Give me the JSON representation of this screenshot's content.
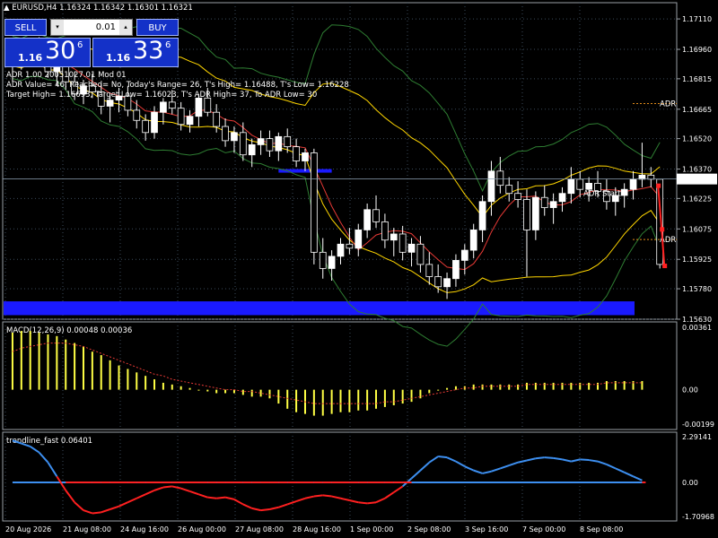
{
  "chart_title": {
    "symbol_tf": "EURUSD,H4",
    "ohlc": "1.16324 1.16342 1.16301 1.16321"
  },
  "trade_panel": {
    "sell_label": "SELL",
    "buy_label": "BUY",
    "lot_value": "0.01",
    "sell_price_small": "1.16",
    "sell_price_big": "30",
    "sell_price_sup": "6",
    "buy_price_small": "1.16",
    "buy_price_big": "33",
    "buy_price_sup": "6"
  },
  "indicator_info": {
    "line1": "ADR 1.00 20051027.01 Mod 01",
    "line2": "ADR Value= 46, Reached= No, Today's Range= 26, T's High= 1.16488, T's Low= 1.16228",
    "line3": "Target High= 1.16693, Target Low= 1.16023, T's ADR High= 37, To ADR Low= 30"
  },
  "chart_labels": {
    "adr_high": "ADR",
    "adr_low": "ADR",
    "adr_start": "ADR Start",
    "current_price": "1.16321"
  },
  "colors": {
    "background": "#000000",
    "grid": "#3a4a5a",
    "bull_candle": "#ffffff",
    "bear_candle": "#000000",
    "band_outer": "#2e7d32",
    "band_inner": "#ffd600",
    "ma_red": "#e53935",
    "zone_blue": "#1a1aff",
    "macd_hist": "#ffff44",
    "macd_signal": "#e53935",
    "trend_up": "#3d8ff0",
    "trend_down": "#ff2020",
    "adr_orange": "#e08a1a"
  },
  "chart_data": [
    {
      "type": "candlestick",
      "symbol": "EURUSD",
      "timeframe": "H4",
      "title": "EURUSD,H4 1.16324 1.16342 1.16301 1.16321",
      "ylim": [
        1.1563,
        1.1719
      ],
      "y_ticks": [
        "1.17110",
        "1.16960",
        "1.16815",
        "1.16665",
        "1.16520",
        "1.16370",
        "1.16225",
        "1.16075",
        "1.15925",
        "1.15780",
        "1.15630"
      ],
      "x_ticks": [
        "20 Aug 2026",
        "21 Aug 08:00",
        "24 Aug 16:00",
        "26 Aug 00:00",
        "27 Aug 08:00",
        "28 Aug 16:00",
        "1 Sep 00:00",
        "2 Sep 08:00",
        "3 Sep 16:00",
        "7 Sep 00:00",
        "8 Sep 08:00"
      ],
      "last_price": 1.16321,
      "adr_target_high": 1.16693,
      "adr_target_low": 1.16023,
      "candles": [
        [
          1.1688,
          1.1694,
          1.168,
          1.1692
        ],
        [
          1.1692,
          1.1697,
          1.1686,
          1.169
        ],
        [
          1.169,
          1.1699,
          1.1688,
          1.1697
        ],
        [
          1.1697,
          1.1702,
          1.169,
          1.1693
        ],
        [
          1.1693,
          1.1697,
          1.1682,
          1.1685
        ],
        [
          1.1685,
          1.1692,
          1.1678,
          1.1689
        ],
        [
          1.1689,
          1.1694,
          1.1676,
          1.168
        ],
        [
          1.168,
          1.1685,
          1.1671,
          1.1674
        ],
        [
          1.1674,
          1.1681,
          1.1669,
          1.1678
        ],
        [
          1.1678,
          1.1684,
          1.1672,
          1.1675
        ],
        [
          1.1675,
          1.1679,
          1.1664,
          1.1668
        ],
        [
          1.1668,
          1.1674,
          1.166,
          1.1671
        ],
        [
          1.1671,
          1.1677,
          1.1665,
          1.1673
        ],
        [
          1.1673,
          1.1678,
          1.1663,
          1.1666
        ],
        [
          1.1666,
          1.1671,
          1.1657,
          1.1661
        ],
        [
          1.1661,
          1.1664,
          1.1651,
          1.1655
        ],
        [
          1.1655,
          1.1668,
          1.1652,
          1.1665
        ],
        [
          1.1665,
          1.1672,
          1.1659,
          1.167
        ],
        [
          1.167,
          1.1676,
          1.1664,
          1.1667
        ],
        [
          1.1667,
          1.167,
          1.1656,
          1.1659
        ],
        [
          1.1659,
          1.1666,
          1.1655,
          1.1663
        ],
        [
          1.1663,
          1.1674,
          1.1658,
          1.1672
        ],
        [
          1.1672,
          1.1677,
          1.1663,
          1.1665
        ],
        [
          1.1665,
          1.1669,
          1.1655,
          1.1658
        ],
        [
          1.1658,
          1.1662,
          1.1648,
          1.1651
        ],
        [
          1.1651,
          1.1658,
          1.1645,
          1.1655
        ],
        [
          1.1655,
          1.166,
          1.1641,
          1.1644
        ],
        [
          1.1644,
          1.1652,
          1.1638,
          1.1649
        ],
        [
          1.1649,
          1.1656,
          1.1644,
          1.1652
        ],
        [
          1.1652,
          1.1656,
          1.1643,
          1.1646
        ],
        [
          1.1646,
          1.1655,
          1.1641,
          1.1653
        ],
        [
          1.1653,
          1.1657,
          1.1645,
          1.1648
        ],
        [
          1.1648,
          1.1652,
          1.1638,
          1.1641
        ],
        [
          1.1641,
          1.1647,
          1.1636,
          1.1645
        ],
        [
          1.1645,
          1.1647,
          1.159,
          1.1596
        ],
        [
          1.1596,
          1.1603,
          1.1583,
          1.1588
        ],
        [
          1.1588,
          1.1597,
          1.1582,
          1.1594
        ],
        [
          1.1594,
          1.1603,
          1.159,
          1.16
        ],
        [
          1.16,
          1.1608,
          1.1595,
          1.1598
        ],
        [
          1.1598,
          1.161,
          1.1594,
          1.1607
        ],
        [
          1.1607,
          1.162,
          1.1603,
          1.1617
        ],
        [
          1.1617,
          1.1624,
          1.1608,
          1.1611
        ],
        [
          1.1611,
          1.1615,
          1.1598,
          1.1602
        ],
        [
          1.1602,
          1.1608,
          1.1594,
          1.1605
        ],
        [
          1.1605,
          1.1609,
          1.1592,
          1.1596
        ],
        [
          1.1596,
          1.1603,
          1.1589,
          1.16
        ],
        [
          1.16,
          1.1604,
          1.1586,
          1.159
        ],
        [
          1.159,
          1.1596,
          1.158,
          1.1584
        ],
        [
          1.1584,
          1.159,
          1.1576,
          1.1579
        ],
        [
          1.1579,
          1.1586,
          1.1573,
          1.1583
        ],
        [
          1.1583,
          1.1595,
          1.1579,
          1.1592
        ],
        [
          1.1592,
          1.16,
          1.1585,
          1.1597
        ],
        [
          1.1597,
          1.161,
          1.1593,
          1.1607
        ],
        [
          1.1607,
          1.1624,
          1.1601,
          1.1621
        ],
        [
          1.1621,
          1.1641,
          1.1614,
          1.1636
        ],
        [
          1.1636,
          1.1643,
          1.1625,
          1.1629
        ],
        [
          1.1629,
          1.1633,
          1.1621,
          1.1625
        ],
        [
          1.1625,
          1.1631,
          1.1618,
          1.1622
        ],
        [
          1.1622,
          1.1627,
          1.1584,
          1.1607
        ],
        [
          1.1607,
          1.1626,
          1.1602,
          1.1623
        ],
        [
          1.1623,
          1.1629,
          1.1614,
          1.1618
        ],
        [
          1.1618,
          1.1625,
          1.161,
          1.1621
        ],
        [
          1.1621,
          1.1628,
          1.1616,
          1.1625
        ],
        [
          1.1625,
          1.1638,
          1.162,
          1.1632
        ],
        [
          1.1632,
          1.1636,
          1.1623,
          1.1627
        ],
        [
          1.1627,
          1.1633,
          1.1621,
          1.163
        ],
        [
          1.163,
          1.1636,
          1.1623,
          1.1626
        ],
        [
          1.1626,
          1.1632,
          1.1617,
          1.1621
        ],
        [
          1.1621,
          1.1628,
          1.1614,
          1.1624
        ],
        [
          1.1624,
          1.163,
          1.1618,
          1.1627
        ],
        [
          1.1627,
          1.1636,
          1.1622,
          1.1632
        ],
        [
          1.1632,
          1.165,
          1.1628,
          1.1634
        ],
        [
          1.1634,
          1.1638,
          1.1628,
          1.1632
        ],
        [
          1.1632,
          1.1632,
          1.1588,
          1.159
        ]
      ],
      "indicators": [
        {
          "name": "Bollinger outer",
          "color": "green"
        },
        {
          "name": "Envelope inner",
          "color": "yellow"
        },
        {
          "name": "Moving average",
          "color": "red"
        }
      ]
    },
    {
      "type": "bar",
      "title": "MACD(12,26,9) 0.00048 0.00036",
      "ylim": [
        -0.00199,
        0.00361
      ],
      "y_ticks": [
        "0.00361",
        "0.00",
        "-0.00199"
      ],
      "values": [
        0.0033,
        0.0034,
        0.0034,
        0.0033,
        0.0032,
        0.0031,
        0.0029,
        0.0027,
        0.0025,
        0.0022,
        0.002,
        0.0017,
        0.0014,
        0.0012,
        0.001,
        0.0008,
        0.0006,
        0.0004,
        0.0003,
        0.0002,
        0.0001,
        0.0,
        -0.0001,
        -0.0002,
        -0.0002,
        -0.0002,
        -0.0003,
        -0.0004,
        -0.0004,
        -0.0005,
        -0.0008,
        -0.0011,
        -0.0013,
        -0.0014,
        -0.0015,
        -0.0015,
        -0.0014,
        -0.0013,
        -0.0013,
        -0.0012,
        -0.0012,
        -0.0011,
        -0.001,
        -0.0009,
        -0.0008,
        -0.0007,
        -0.0005,
        -0.0002,
        0.0,
        0.0001,
        0.0002,
        0.0002,
        0.0003,
        0.0003,
        0.0003,
        0.0003,
        0.0003,
        0.0003,
        0.0004,
        0.0004,
        0.0004,
        0.0004,
        0.0004,
        0.0004,
        0.0004,
        0.0004,
        0.0004,
        0.0005,
        0.0005,
        0.0005,
        0.0005,
        0.0005
      ],
      "signal": [
        0.0022,
        0.0024,
        0.0025,
        0.0026,
        0.0027,
        0.0027,
        0.0027,
        0.0026,
        0.0025,
        0.0023,
        0.0021,
        0.0019,
        0.0017,
        0.0015,
        0.0013,
        0.0011,
        0.0009,
        0.0008,
        0.0006,
        0.0005,
        0.0004,
        0.0003,
        0.0002,
        0.0001,
        0.0,
        0.0,
        -0.0001,
        -0.0001,
        -0.0002,
        -0.0003,
        -0.0004,
        -0.0005,
        -0.0006,
        -0.0007,
        -0.0008,
        -0.0008,
        -0.0008,
        -0.0008,
        -0.0008,
        -0.0008,
        -0.0008,
        -0.0008,
        -0.0007,
        -0.0007,
        -0.0006,
        -0.0005,
        -0.0004,
        -0.0003,
        -0.0002,
        -0.0001,
        0.0,
        0.0001,
        0.0001,
        0.0002,
        0.0002,
        0.0002,
        0.0002,
        0.0002,
        0.0003,
        0.0003,
        0.0003,
        0.0003,
        0.0003,
        0.0003,
        0.0003,
        0.0003,
        0.0003,
        0.0004,
        0.0004,
        0.0004,
        0.0004,
        0.0004
      ]
    },
    {
      "type": "line",
      "title": "trendline_fast 0.06401",
      "ylim": [
        -1.70968,
        2.29141
      ],
      "y_ticks": [
        "2.29141",
        "0.00",
        "-1.70968"
      ],
      "values": [
        2.1,
        1.95,
        1.8,
        1.5,
        1.0,
        0.3,
        -0.4,
        -1.0,
        -1.4,
        -1.55,
        -1.5,
        -1.35,
        -1.2,
        -1.0,
        -0.8,
        -0.6,
        -0.4,
        -0.25,
        -0.2,
        -0.3,
        -0.45,
        -0.6,
        -0.75,
        -0.8,
        -0.75,
        -0.85,
        -1.1,
        -1.3,
        -1.4,
        -1.35,
        -1.25,
        -1.1,
        -0.95,
        -0.8,
        -0.7,
        -0.65,
        -0.7,
        -0.8,
        -0.9,
        -1.0,
        -1.05,
        -1.0,
        -0.8,
        -0.5,
        -0.2,
        0.2,
        0.6,
        1.0,
        1.3,
        1.25,
        1.05,
        0.8,
        0.6,
        0.45,
        0.55,
        0.7,
        0.85,
        1.0,
        1.1,
        1.2,
        1.25,
        1.22,
        1.15,
        1.05,
        1.15,
        1.12,
        1.05,
        0.9,
        0.7,
        0.5,
        0.3,
        0.1
      ]
    }
  ]
}
